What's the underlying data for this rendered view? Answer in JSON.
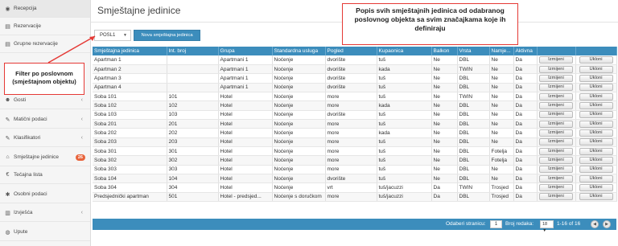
{
  "sidebar": {
    "items": [
      {
        "label": "Recepcija",
        "icon": "dashboard-icon",
        "glyph": "◉",
        "chevron": "",
        "badge": ""
      },
      {
        "label": "Rezervacije",
        "icon": "list-icon",
        "glyph": "▤",
        "chevron": "",
        "badge": ""
      },
      {
        "label": "Grupne rezervacije",
        "icon": "list-icon",
        "glyph": "▤",
        "chevron": "",
        "badge": ""
      },
      {
        "label": "Gosti",
        "icon": "users-icon",
        "glyph": "☻",
        "chevron": "‹",
        "badge": ""
      },
      {
        "label": "Matični podaci",
        "icon": "edit-icon",
        "glyph": "✎",
        "chevron": "‹",
        "badge": ""
      },
      {
        "label": "Klasifikatori",
        "icon": "edit-icon",
        "glyph": "✎",
        "chevron": "‹",
        "badge": ""
      },
      {
        "label": "Smještajne jedinice",
        "icon": "home-icon",
        "glyph": "⌂",
        "chevron": "",
        "badge": "26"
      },
      {
        "label": "Tečajna lista",
        "icon": "euro-icon",
        "glyph": "€",
        "chevron": "",
        "badge": ""
      },
      {
        "label": "Osobni podaci",
        "icon": "gear-icon",
        "glyph": "✱",
        "chevron": "",
        "badge": ""
      },
      {
        "label": "Izvješća",
        "icon": "bar-chart-icon",
        "glyph": "▥",
        "chevron": "‹",
        "badge": ""
      },
      {
        "label": "Upute",
        "icon": "help-icon",
        "glyph": "◍",
        "chevron": "",
        "badge": ""
      }
    ]
  },
  "header": {
    "title": "Smještajne jedinice"
  },
  "toolbar": {
    "filter_value": "POSL1",
    "filter_caret": "▼",
    "new_button": "Nova smještajna jedinica"
  },
  "table": {
    "columns": [
      "Smještajna jedinica",
      "Int. broj",
      "Grupa",
      "Standardna usluga",
      "Pogled",
      "Kupaonica",
      "Balkon",
      "Vrsta",
      "Namje...",
      "Aktivna",
      "",
      ""
    ],
    "edit_label": "Izmijeni",
    "delete_label": "Ukloni",
    "rows": [
      [
        "Apartman 1",
        "",
        "Apartmani 1",
        "Noćenje",
        "dvorište",
        "tuš",
        "Ne",
        "DBL",
        "Ne",
        "Da"
      ],
      [
        "Apartman 2",
        "",
        "Apartmani 1",
        "Noćenje",
        "dvorište",
        "kada",
        "Ne",
        "TWIN",
        "Ne",
        "Da"
      ],
      [
        "Apartman 3",
        "",
        "Apartmani 1",
        "Noćenje",
        "dvorište",
        "tuš",
        "Ne",
        "DBL",
        "Ne",
        "Da"
      ],
      [
        "Apartman 4",
        "",
        "Apartmani 1",
        "Noćenje",
        "dvorište",
        "tuš",
        "Ne",
        "DBL",
        "Ne",
        "Da"
      ],
      [
        "Soba 101",
        "101",
        "Hotel",
        "Noćenje",
        "more",
        "tuš",
        "Ne",
        "TWIN",
        "Ne",
        "Da"
      ],
      [
        "Soba 102",
        "102",
        "Hotel",
        "Noćenje",
        "more",
        "kada",
        "Ne",
        "DBL",
        "Ne",
        "Da"
      ],
      [
        "Soba 103",
        "103",
        "Hotel",
        "Noćenje",
        "dvorište",
        "tuš",
        "Ne",
        "DBL",
        "Ne",
        "Da"
      ],
      [
        "Soba 201",
        "201",
        "Hotel",
        "Noćenje",
        "more",
        "tuš",
        "Ne",
        "DBL",
        "Ne",
        "Da"
      ],
      [
        "Soba 202",
        "202",
        "Hotel",
        "Noćenje",
        "more",
        "kada",
        "Ne",
        "DBL",
        "Ne",
        "Da"
      ],
      [
        "Soba 203",
        "203",
        "Hotel",
        "Noćenje",
        "more",
        "tuš",
        "Ne",
        "DBL",
        "Ne",
        "Da"
      ],
      [
        "Soba 301",
        "301",
        "Hotel",
        "Noćenje",
        "more",
        "tuš",
        "Ne",
        "DBL",
        "Fotelja",
        "Da"
      ],
      [
        "Soba 302",
        "302",
        "Hotel",
        "Noćenje",
        "more",
        "tuš",
        "Ne",
        "DBL",
        "Fotelja",
        "Da"
      ],
      [
        "Soba 303",
        "303",
        "Hotel",
        "Noćenje",
        "more",
        "tuš",
        "Ne",
        "DBL",
        "Ne",
        "Da"
      ],
      [
        "Soba 104",
        "104",
        "Hotel",
        "Noćenje",
        "dvorište",
        "tuš",
        "Ne",
        "DBL",
        "Ne",
        "Da"
      ],
      [
        "Soba 304",
        "304",
        "Hotel",
        "Noćenje",
        "vrt",
        "tuš/jacuzzi",
        "Da",
        "TWIN",
        "Trosjed",
        "Da"
      ],
      [
        "Predsjednički apartman",
        "501",
        "Hotel - predsjed...",
        "Noćenje s doručkom",
        "more",
        "tuš/jacuzzi",
        "Da",
        "DBL",
        "Trosjed",
        "Da"
      ]
    ]
  },
  "pager": {
    "page_label": "Odaberi stranicu:",
    "page_value": "1",
    "rows_label": "Broj redaka:",
    "rows_value": "18 ▼",
    "range": "1-16 of 16",
    "prev": "◀",
    "next": "▶"
  },
  "annotations": {
    "top": "Popis svih smještajnih jedinica od odabranog poslovnog objekta sa svim značajkama koje ih definiraju",
    "left": "Filter po poslovnom (smještajnom objektu)",
    "color": "#e53935"
  },
  "colors": {
    "primary": "#3c8dbc",
    "badge": "#e8643c"
  }
}
